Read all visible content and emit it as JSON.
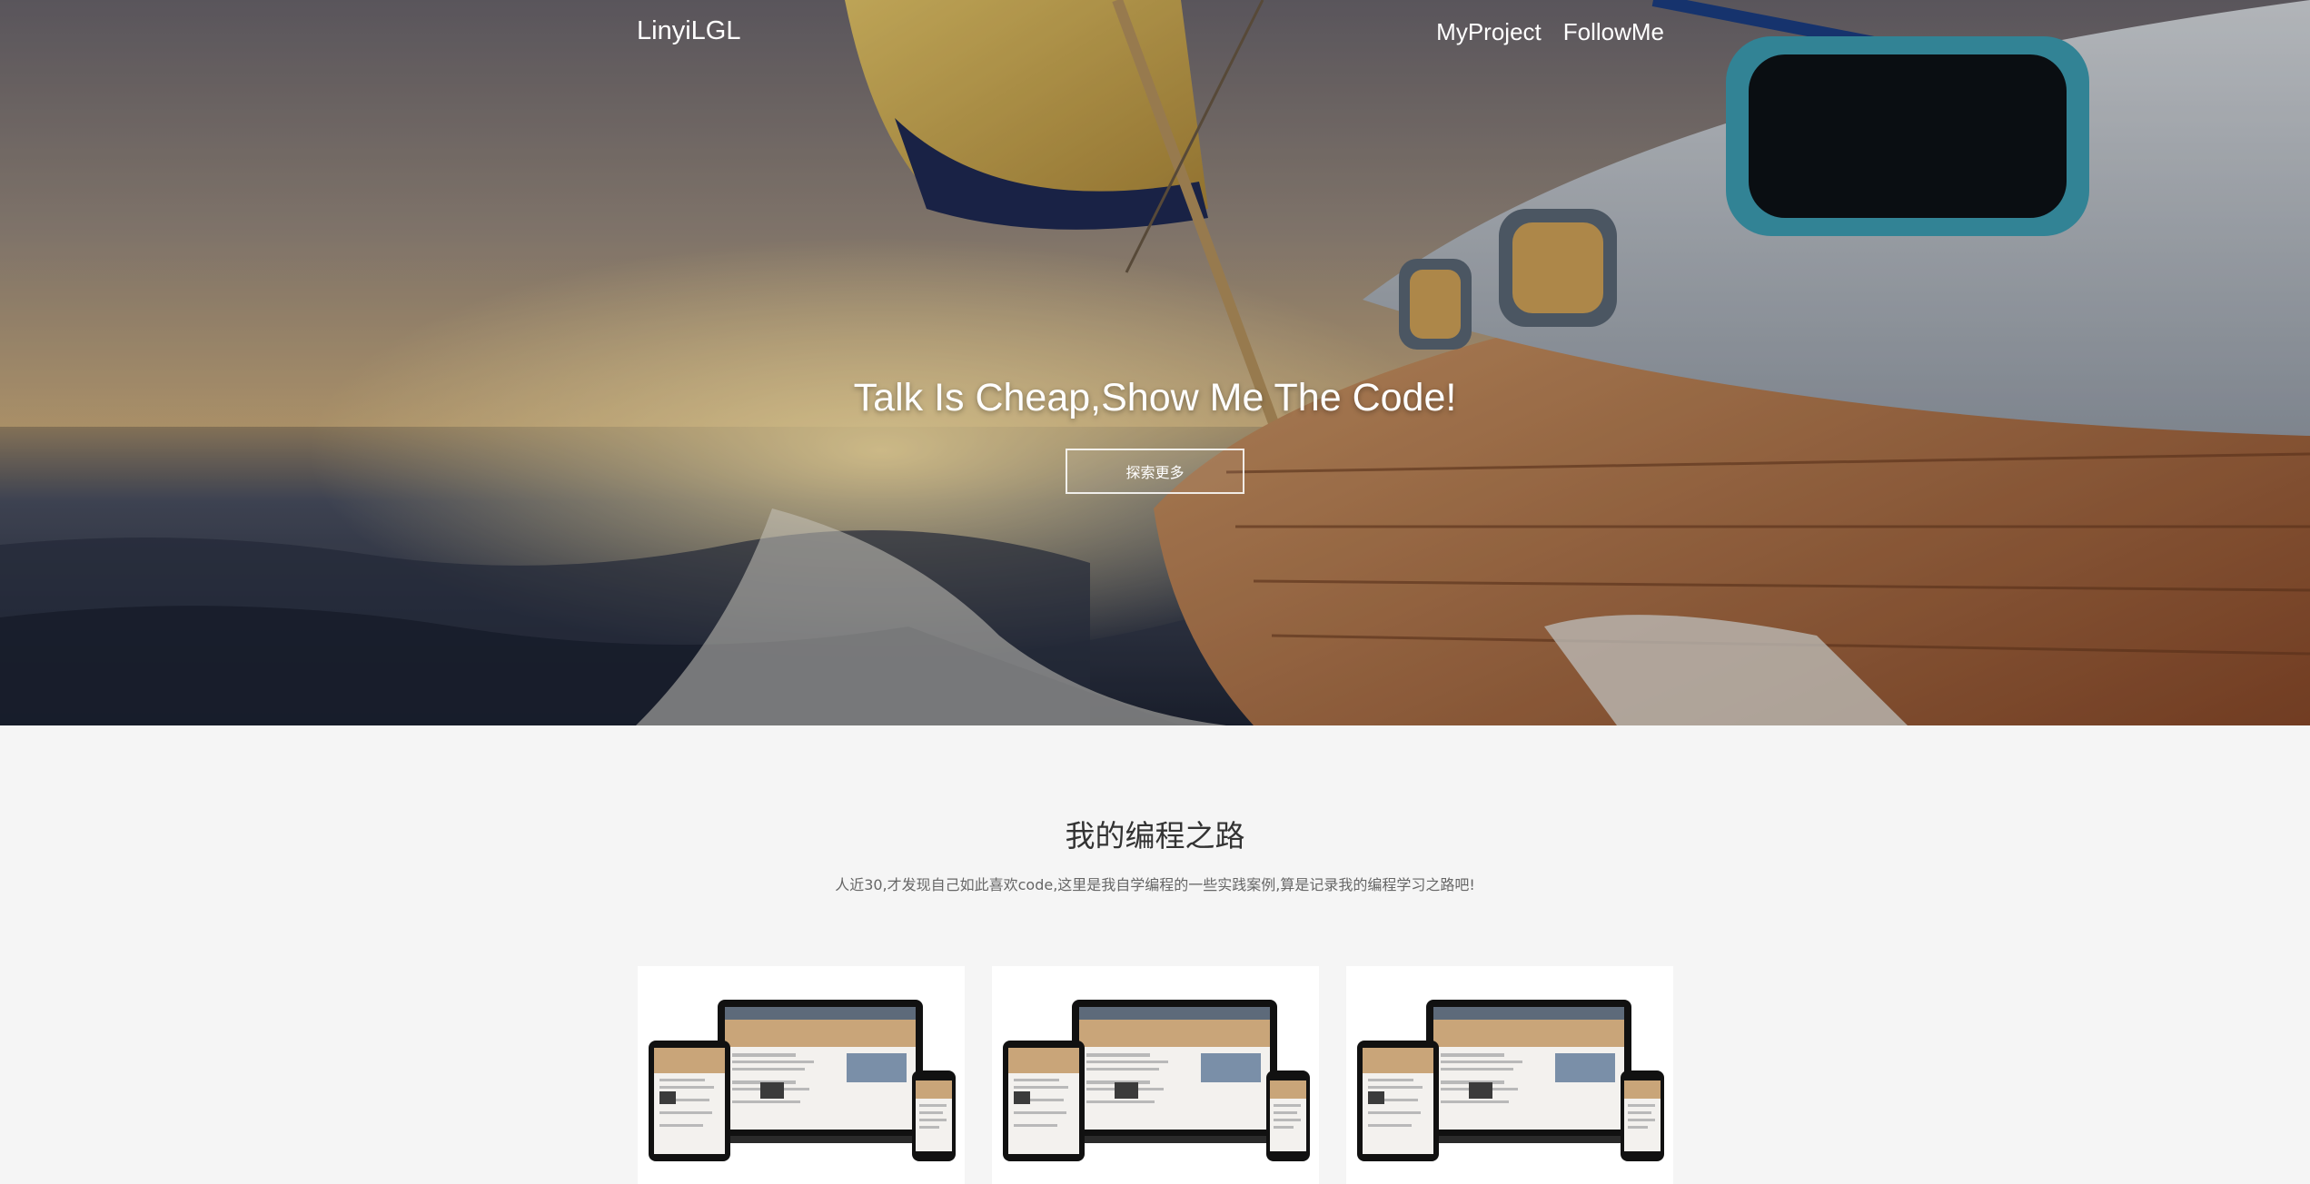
{
  "nav": {
    "brand": "LinyiLGL",
    "links": [
      "MyProject",
      "FollowMe"
    ]
  },
  "hero": {
    "title": "Talk Is Cheap,Show Me The Code!",
    "button_label": "探索更多"
  },
  "section": {
    "title": "我的编程之路",
    "description": "人近30,才发现自己如此喜欢code,这里是我自学编程的一些实践案例,算是记录我的编程学习之路吧!"
  },
  "cards": [
    {
      "image": "responsive-devices-mockup"
    },
    {
      "image": "responsive-devices-mockup"
    },
    {
      "image": "responsive-devices-mockup"
    }
  ]
}
